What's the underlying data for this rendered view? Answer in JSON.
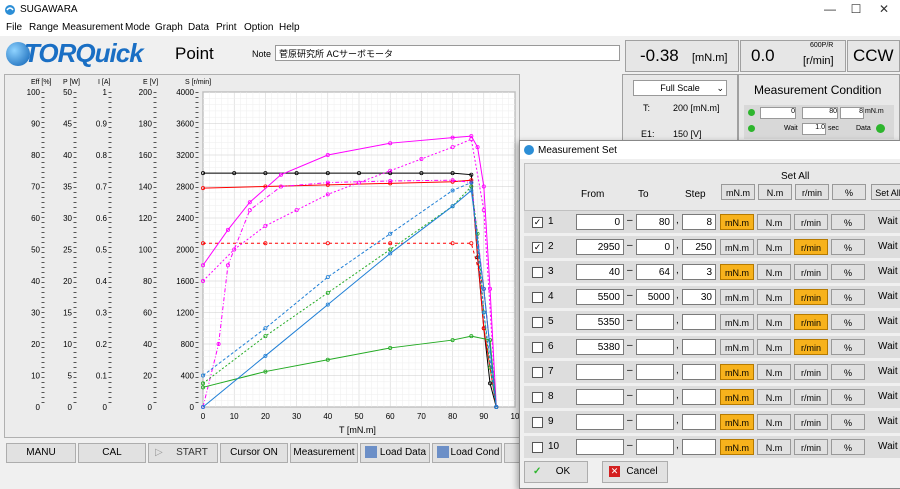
{
  "window": {
    "title": "SUGAWARA"
  },
  "menu": [
    "File",
    "Range",
    "Measurement",
    "Mode",
    "Graph",
    "Data",
    "Print",
    "Option",
    "Help"
  ],
  "header": {
    "brand": "TORQuick",
    "mode": "Point",
    "note_label": "Note",
    "note_value": "菅原研究所 ACサーボモータ",
    "torque_value": "-0.38",
    "torque_unit": "[mN.m]",
    "speed_value": "0.0",
    "speed_ppr": "600P/R",
    "speed_unit": "[r/min]",
    "direction": "CCW"
  },
  "side_panel": {
    "scale": "Full Scale",
    "t_label": "T:",
    "t_value": "200 [mN.m]",
    "e1_label": "E1:",
    "e1_value": "150 [V]"
  },
  "condition_panel": {
    "title": "Measurement Condition",
    "row1_a": "0",
    "row1_b": "80",
    "row1_c": "8",
    "row1_unit": "mN.m",
    "wait_label": "Wait",
    "wait_value": "1.0",
    "wait_unit": "sec",
    "data_label": "Data"
  },
  "chart": {
    "axes": [
      {
        "name": "Eff [%]",
        "ticks": [
          "100",
          "90",
          "80",
          "70",
          "60",
          "50",
          "40",
          "30",
          "20",
          "10",
          "0"
        ]
      },
      {
        "name": "P [W]",
        "ticks": [
          "50",
          "45",
          "40",
          "35",
          "30",
          "25",
          "20",
          "15",
          "10",
          "5",
          "0"
        ]
      },
      {
        "name": "I [A]",
        "ticks": [
          "1",
          "0.9",
          "0.8",
          "0.7",
          "0.6",
          "0.5",
          "0.4",
          "0.3",
          "0.2",
          "0.1",
          "0"
        ]
      },
      {
        "name": "E [V]",
        "ticks": [
          "200",
          "180",
          "160",
          "140",
          "120",
          "100",
          "80",
          "60",
          "40",
          "20",
          "0"
        ]
      },
      {
        "name": "S [r/min]",
        "ticks": [
          "4000",
          "3600",
          "3200",
          "2800",
          "2400",
          "2000",
          "1600",
          "1200",
          "800",
          "400",
          "0"
        ]
      }
    ],
    "x_ticks": [
      "0",
      "10",
      "20",
      "30",
      "40",
      "50",
      "60",
      "70",
      "80",
      "90",
      "10"
    ],
    "x_label": "T [mN.m]"
  },
  "chart_data": {
    "type": "line",
    "x_range": [
      0,
      100
    ],
    "y_range_speed": [
      0,
      4000
    ],
    "grid": true,
    "series": [
      {
        "color": "#000000",
        "x": [
          0,
          10,
          20,
          30,
          40,
          50,
          60,
          70,
          80,
          86,
          88,
          90,
          92,
          94
        ],
        "y": [
          2970,
          2970,
          2970,
          2970,
          2970,
          2970,
          2970,
          2970,
          2970,
          2950,
          1900,
          1000,
          300,
          0
        ]
      },
      {
        "color": "#ff0000",
        "x": [
          0,
          20,
          40,
          60,
          80,
          86,
          90,
          94
        ],
        "y": [
          2780,
          2800,
          2820,
          2840,
          2860,
          2880,
          1000,
          0
        ]
      },
      {
        "color": "#ff0000",
        "x": [
          0,
          20,
          40,
          60,
          80,
          86,
          90,
          94
        ],
        "y": [
          2080,
          2080,
          2080,
          2080,
          2080,
          2080,
          1500,
          0
        ]
      },
      {
        "color": "#ff00ff",
        "x": [
          0,
          8,
          15,
          25,
          40,
          60,
          80,
          86,
          88,
          90,
          92,
          94
        ],
        "y": [
          1800,
          2250,
          2600,
          2950,
          3200,
          3350,
          3420,
          3440,
          3300,
          2800,
          1500,
          0
        ]
      },
      {
        "color": "#ff00ff",
        "x": [
          0,
          5,
          8,
          15,
          25,
          40,
          60,
          80,
          86,
          90,
          94
        ],
        "y": [
          0,
          800,
          1800,
          2500,
          2800,
          2850,
          2870,
          2880,
          2850,
          1500,
          0
        ]
      },
      {
        "color": "#ff00ff",
        "x": [
          0,
          10,
          20,
          30,
          40,
          50,
          60,
          70,
          80,
          86,
          90,
          94
        ],
        "y": [
          1600,
          2000,
          2300,
          2500,
          2700,
          2850,
          3000,
          3150,
          3300,
          3400,
          2500,
          0
        ]
      },
      {
        "color": "#22aa22",
        "x": [
          0,
          20,
          40,
          60,
          80,
          86,
          88,
          90,
          92,
          94
        ],
        "y": [
          300,
          900,
          1450,
          2000,
          2550,
          2800,
          2200,
          1200,
          500,
          0
        ]
      },
      {
        "color": "#22aa22",
        "x": [
          0,
          20,
          40,
          60,
          80,
          86,
          92,
          94
        ],
        "y": [
          250,
          450,
          600,
          750,
          850,
          900,
          850,
          0
        ]
      },
      {
        "color": "#1f7fd6",
        "x": [
          0,
          20,
          40,
          60,
          80,
          86,
          90,
          94
        ],
        "y": [
          0,
          650,
          1300,
          1950,
          2550,
          2750,
          1500,
          0
        ]
      },
      {
        "color": "#1f7fd6",
        "x": [
          0,
          20,
          40,
          60,
          80,
          86,
          90,
          94
        ],
        "y": [
          400,
          1000,
          1650,
          2200,
          2750,
          2850,
          1200,
          0
        ]
      }
    ]
  },
  "buttons": {
    "manu": "MANU",
    "cal": "CAL",
    "start": "START",
    "cursor": "Cursor ON",
    "measurement": "Measurement",
    "load_data": "Load Data",
    "load_cond": "Load Cond"
  },
  "dialog": {
    "title": "Measurement Set",
    "col_from": "From",
    "col_to": "To",
    "col_step": "Step",
    "set_all": "Set All",
    "set_all_btn": "Set All",
    "units": [
      "mN.m",
      "N.m",
      "r/min",
      "%"
    ],
    "wait": "Wait",
    "ok": "OK",
    "cancel": "Cancel",
    "rows": [
      {
        "n": "1",
        "checked": true,
        "from": "0",
        "to": "80",
        "step": "8",
        "unit": 0
      },
      {
        "n": "2",
        "checked": true,
        "from": "2950",
        "to": "0",
        "step": "250",
        "unit": 2
      },
      {
        "n": "3",
        "checked": false,
        "from": "40",
        "to": "64",
        "step": "3",
        "unit": 0
      },
      {
        "n": "4",
        "checked": false,
        "from": "5500",
        "to": "5000",
        "step": "30",
        "unit": 2
      },
      {
        "n": "5",
        "checked": false,
        "from": "5350",
        "to": "",
        "step": "",
        "unit": 2
      },
      {
        "n": "6",
        "checked": false,
        "from": "5380",
        "to": "",
        "step": "",
        "unit": 2
      },
      {
        "n": "7",
        "checked": false,
        "from": "",
        "to": "",
        "step": "",
        "unit": 0
      },
      {
        "n": "8",
        "checked": false,
        "from": "",
        "to": "",
        "step": "",
        "unit": 0
      },
      {
        "n": "9",
        "checked": false,
        "from": "",
        "to": "",
        "step": "",
        "unit": 0
      },
      {
        "n": "10",
        "checked": false,
        "from": "",
        "to": "",
        "step": "",
        "unit": 0
      }
    ]
  }
}
